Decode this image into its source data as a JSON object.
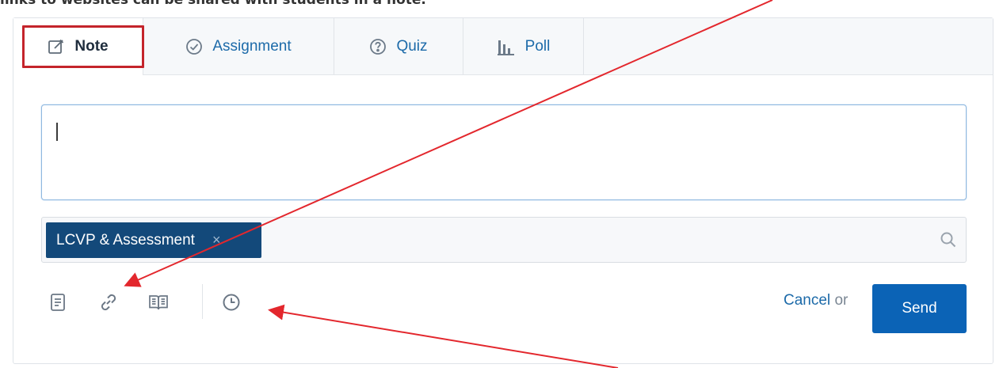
{
  "caption": "links to websites can be shared with students in a note.",
  "tabs": [
    {
      "label": "Note",
      "icon": "note-edit-icon",
      "active": true
    },
    {
      "label": "Assignment",
      "icon": "check-circle-icon",
      "active": false
    },
    {
      "label": "Quiz",
      "icon": "question-circle-icon",
      "active": false
    },
    {
      "label": "Poll",
      "icon": "bar-chart-icon",
      "active": false
    }
  ],
  "message": {
    "placeholder": "",
    "value": ""
  },
  "recipients": {
    "tags": [
      {
        "label": "LCVP & Assessment",
        "remove": "×"
      }
    ],
    "search_icon": "search-icon"
  },
  "toolbar": {
    "icons": [
      "file-icon",
      "link-icon",
      "library-icon",
      "schedule-clock-icon"
    ]
  },
  "actions": {
    "cancel_label": "Cancel",
    "or_label": "or",
    "send_label": "Send"
  },
  "colors": {
    "annotation_red": "#c4242b",
    "send_blue": "#0b63b6",
    "tag_navy": "#13497a",
    "link_blue": "#1c6aa9"
  }
}
